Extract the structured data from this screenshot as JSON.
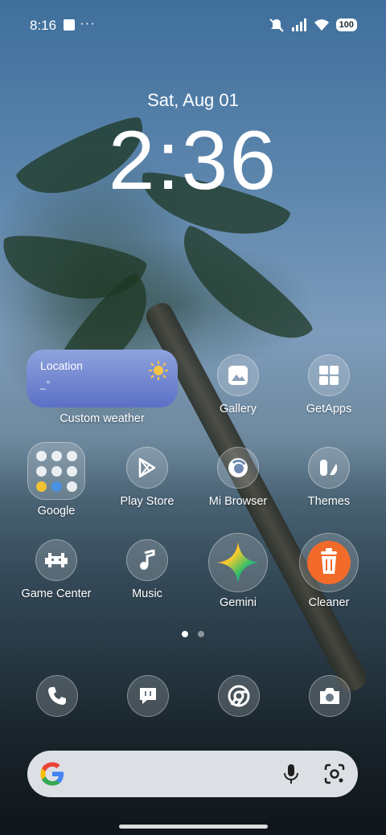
{
  "status_bar": {
    "time": "8:16",
    "dots": "···",
    "battery": "100"
  },
  "clock": {
    "date": "Sat, Aug 01",
    "time": "2:36"
  },
  "weather_widget": {
    "location": "Location",
    "temperature": "_°",
    "label": "Custom weather"
  },
  "apps": {
    "gallery": "Gallery",
    "getapps": "GetApps",
    "google": "Google",
    "playstore": "Play Store",
    "mibrowser": "Mi Browser",
    "themes": "Themes",
    "gamecenter": "Game Center",
    "music": "Music",
    "gemini": "Gemini",
    "cleaner": "Cleaner"
  },
  "dock": [
    "phone-icon",
    "messages-icon",
    "chrome-icon",
    "camera-icon"
  ],
  "colors": {
    "weather_widget": "#5b70c6",
    "cleaner_orange": "#f26b2b",
    "sun": "#f6c546"
  }
}
